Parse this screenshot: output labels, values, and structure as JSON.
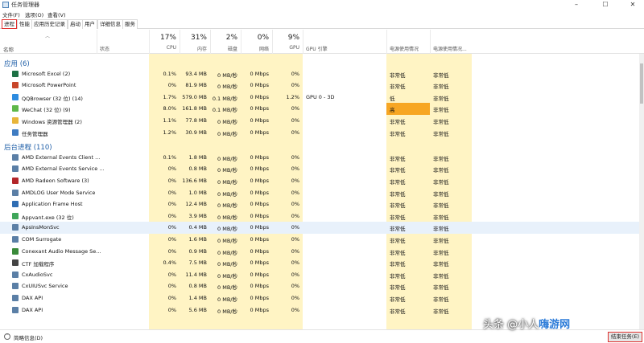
{
  "window": {
    "title": "任务管理器"
  },
  "menu": [
    "文件(F)",
    "选项(O)",
    "查看(V)"
  ],
  "tabs": [
    "进程",
    "性能",
    "应用历史记录",
    "启动",
    "用户",
    "详细信息",
    "服务"
  ],
  "columns": {
    "name": "名称",
    "status": "状态",
    "cpu": {
      "pct": "17%",
      "label": "CPU"
    },
    "memory": {
      "pct": "31%",
      "label": "内存"
    },
    "disk": {
      "pct": "2%",
      "label": "磁盘"
    },
    "network": {
      "pct": "0%",
      "label": "网络"
    },
    "gpu": {
      "pct": "9%",
      "label": "GPU"
    },
    "gpu_engine": "GPU 引擎",
    "power": "电源使用情况",
    "power_trend": "电源使用情况..."
  },
  "groups": {
    "apps": "应用 (6)",
    "background": "后台进程 (110)"
  },
  "apps": [
    {
      "name": "Microsoft Excel (2)",
      "cpu": "0.1%",
      "mem": "93.4 MB",
      "disk": "0 MB/秒",
      "net": "0 Mbps",
      "gpu": "0%",
      "engine": "",
      "power": "非常低",
      "trend": "非常低",
      "icon": "excel-icon",
      "color": "#1d7044",
      "expand": true
    },
    {
      "name": "Microsoft PowerPoint",
      "cpu": "0%",
      "mem": "81.9 MB",
      "disk": "0 MB/秒",
      "net": "0 Mbps",
      "gpu": "0%",
      "engine": "",
      "power": "非常低",
      "trend": "非常低",
      "icon": "powerpoint-icon",
      "color": "#c8462a",
      "expand": true
    },
    {
      "name": "QQBrowser (32 位) (14)",
      "cpu": "1.7%",
      "mem": "579.0 MB",
      "disk": "0.1 MB/秒",
      "net": "0 Mbps",
      "gpu": "1.2%",
      "engine": "GPU 0 - 3D",
      "power": "低",
      "trend": "非常低",
      "icon": "qqbrowser-icon",
      "color": "#2d8ce0",
      "expand": true
    },
    {
      "name": "WeChat (32 位) (9)",
      "cpu": "8.0%",
      "mem": "161.8 MB",
      "disk": "0.1 MB/秒",
      "net": "0 Mbps",
      "gpu": "0%",
      "engine": "",
      "power": "高",
      "trend": "非常低",
      "icon": "wechat-icon",
      "color": "#5fb84a",
      "expand": true,
      "hot": true
    },
    {
      "name": "Windows 资源管理器 (2)",
      "cpu": "1.1%",
      "mem": "77.8 MB",
      "disk": "0 MB/秒",
      "net": "0 Mbps",
      "gpu": "0%",
      "engine": "",
      "power": "非常低",
      "trend": "非常低",
      "icon": "folder-icon",
      "color": "#e8b53a",
      "expand": true
    },
    {
      "name": "任务管理器",
      "cpu": "1.2%",
      "mem": "30.9 MB",
      "disk": "0 MB/秒",
      "net": "0 Mbps",
      "gpu": "0%",
      "engine": "",
      "power": "非常低",
      "trend": "非常低",
      "icon": "task-manager-icon",
      "color": "#3f7cc2",
      "expand": true
    }
  ],
  "background": [
    {
      "name": "AMD External Events Client ...",
      "cpu": "0.1%",
      "mem": "1.8 MB",
      "disk": "0 MB/秒",
      "net": "0 Mbps",
      "gpu": "0%",
      "power": "非常低",
      "trend": "非常低",
      "icon": "service-icon",
      "color": "#5b7fa6",
      "expand": false
    },
    {
      "name": "AMD External Events Service ...",
      "cpu": "0%",
      "mem": "0.8 MB",
      "disk": "0 MB/秒",
      "net": "0 Mbps",
      "gpu": "0%",
      "power": "非常低",
      "trend": "非常低",
      "icon": "service-icon",
      "color": "#5b7fa6",
      "expand": true
    },
    {
      "name": "AMD Radeon Software (3)",
      "cpu": "0%",
      "mem": "136.6 MB",
      "disk": "0 MB/秒",
      "net": "0 Mbps",
      "gpu": "0%",
      "power": "非常低",
      "trend": "非常低",
      "icon": "amd-radeon-icon",
      "color": "#b3262a",
      "expand": true
    },
    {
      "name": "AMDLOG User Mode Service",
      "cpu": "0%",
      "mem": "1.0 MB",
      "disk": "0 MB/秒",
      "net": "0 Mbps",
      "gpu": "0%",
      "power": "非常低",
      "trend": "非常低",
      "icon": "service-icon",
      "color": "#5b7fa6",
      "expand": true
    },
    {
      "name": "Application Frame Host",
      "cpu": "0%",
      "mem": "12.4 MB",
      "disk": "0 MB/秒",
      "net": "0 Mbps",
      "gpu": "0%",
      "power": "非常低",
      "trend": "非常低",
      "icon": "app-frame-icon",
      "color": "#2f6db3",
      "expand": false
    },
    {
      "name": "Appvant.exe (32 位)",
      "cpu": "0%",
      "mem": "3.9 MB",
      "disk": "0 MB/秒",
      "net": "0 Mbps",
      "gpu": "0%",
      "power": "非常低",
      "trend": "非常低",
      "icon": "appvant-icon",
      "color": "#3fa65a",
      "expand": false
    },
    {
      "name": "ApsInsMonSvc",
      "cpu": "0%",
      "mem": "0.4 MB",
      "disk": "0 MB/秒",
      "net": "0 Mbps",
      "gpu": "0%",
      "power": "非常低",
      "trend": "非常低",
      "icon": "service-icon",
      "color": "#5b7fa6",
      "expand": true,
      "selected": true
    },
    {
      "name": "COM Surrogate",
      "cpu": "0%",
      "mem": "1.6 MB",
      "disk": "0 MB/秒",
      "net": "0 Mbps",
      "gpu": "0%",
      "power": "非常低",
      "trend": "非常低",
      "icon": "service-icon",
      "color": "#5b7fa6",
      "expand": false
    },
    {
      "name": "Conexant Audio Message Se...",
      "cpu": "0%",
      "mem": "0.9 MB",
      "disk": "0 MB/秒",
      "net": "0 Mbps",
      "gpu": "0%",
      "power": "非常低",
      "trend": "非常低",
      "icon": "conexant-icon",
      "color": "#3a8a3a",
      "expand": true
    },
    {
      "name": "CTF 加载程序",
      "cpu": "0.4%",
      "mem": "7.5 MB",
      "disk": "0 MB/秒",
      "net": "0 Mbps",
      "gpu": "0%",
      "power": "非常低",
      "trend": "非常低",
      "icon": "ctf-loader-icon",
      "color": "#444444",
      "expand": false
    },
    {
      "name": "CxAudioSvc",
      "cpu": "0%",
      "mem": "11.4 MB",
      "disk": "0 MB/秒",
      "net": "0 Mbps",
      "gpu": "0%",
      "power": "非常低",
      "trend": "非常低",
      "icon": "service-icon",
      "color": "#5b7fa6",
      "expand": true
    },
    {
      "name": "CxUIUSvc Service",
      "cpu": "0%",
      "mem": "0.8 MB",
      "disk": "0 MB/秒",
      "net": "0 Mbps",
      "gpu": "0%",
      "power": "非常低",
      "trend": "非常低",
      "icon": "service-icon",
      "color": "#5b7fa6",
      "expand": true
    },
    {
      "name": "DAX API",
      "cpu": "0%",
      "mem": "1.4 MB",
      "disk": "0 MB/秒",
      "net": "0 Mbps",
      "gpu": "0%",
      "power": "非常低",
      "trend": "非常低",
      "icon": "service-icon",
      "color": "#5b7fa6",
      "expand": true
    },
    {
      "name": "DAX API",
      "cpu": "0%",
      "mem": "5.6 MB",
      "disk": "0 MB/秒",
      "net": "0 Mbps",
      "gpu": "0%",
      "power": "非常低",
      "trend": "非常低",
      "icon": "service-icon",
      "color": "#5b7fa6",
      "expand": false
    }
  ],
  "footer": {
    "fewer_details": "简略信息(D)",
    "end_task": "结束任务(E)"
  },
  "watermark": {
    "prefix": "头条 @小人",
    "brand": "嗨游网"
  },
  "colors": {
    "heat_light": "#fff4c4",
    "heat_high": "#f7a623",
    "selected_row": "#e8f1fb",
    "highlight_border": "#e0312f",
    "group_title": "#1f5fa8"
  }
}
